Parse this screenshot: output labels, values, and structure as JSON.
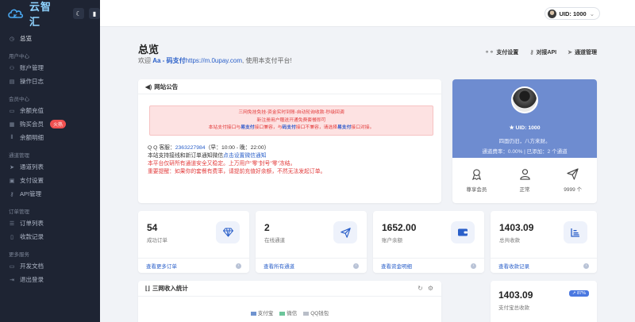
{
  "app": {
    "logo_text": "云智汇"
  },
  "sidebar": {
    "items": [
      {
        "type": "item",
        "icon": "dashboard-icon",
        "label": "总览",
        "active": true
      },
      {
        "type": "group",
        "label": "用户中心"
      },
      {
        "type": "item",
        "icon": "user-icon",
        "label": "账户管理"
      },
      {
        "type": "item",
        "icon": "log-icon",
        "label": "操作日志"
      },
      {
        "type": "group",
        "label": "会员中心"
      },
      {
        "type": "item",
        "icon": "wallet-icon",
        "label": "余额充值"
      },
      {
        "type": "item",
        "icon": "vip-icon",
        "label": "购买会员",
        "badge": "火热"
      },
      {
        "type": "item",
        "icon": "list-icon",
        "label": "余额明细"
      },
      {
        "type": "group",
        "label": "通道管理"
      },
      {
        "type": "item",
        "icon": "send-icon",
        "label": "通道列表"
      },
      {
        "type": "item",
        "icon": "settings-icon",
        "label": "支付设置"
      },
      {
        "type": "item",
        "icon": "key-icon",
        "label": "API管理"
      },
      {
        "type": "group",
        "label": "订单管理"
      },
      {
        "type": "item",
        "icon": "order-icon",
        "label": "订单列表"
      },
      {
        "type": "item",
        "icon": "record-icon",
        "label": "收款记录"
      },
      {
        "type": "group",
        "label": "更多服务"
      },
      {
        "type": "item",
        "icon": "doc-icon",
        "label": "开发文档"
      },
      {
        "type": "item",
        "icon": "logout-icon",
        "label": "退出登录"
      }
    ]
  },
  "topbar": {
    "uid_label": "UID: 1000"
  },
  "page": {
    "title": "总览",
    "welcome_prefix": "欢迎 ",
    "welcome_user": "Aa - 码支付",
    "welcome_site": "https://m.0upay.com",
    "welcome_suffix": ", 使用本支付平台!",
    "quick_links": [
      "支付设置",
      "对接API",
      "通道管理"
    ]
  },
  "notice": {
    "title": "网站公告",
    "alert_line1": "三网免挂免挂-资金实时到账-自动轮询收款-秒级回调",
    "alert_line2": "新注册用户赠送开通免费套餐即可",
    "alert_line3_a": "本站支付接口与",
    "alert_line3_b": "易支付",
    "alert_line3_c": "接口兼容，与",
    "alert_line3_d": "码支付",
    "alert_line3_e": "接口不兼容，请选择",
    "alert_line3_f": "易支付",
    "alert_line3_g": "接口对接。",
    "qq_prefix": "Q Q 客服：",
    "qq_number": "2363227984",
    "qq_hours": "（早：10:00 - 晚：22:00）",
    "wechat_prefix": "本站支持接线和新订单通知微信",
    "wechat_link": "点击设置微信通知",
    "risk_notice": "本平台仅研所有通道安全又稳定。上万用户\"零\"封号\"零\"冻结。",
    "warning": "重要提醒：如果你的套餐有费率，请提前充值好余额，不然无法发起订单。"
  },
  "profile": {
    "uid": "UID: 1000",
    "motto": "四面仍旧，八方来财。",
    "rate": "通道费率：0.00% | 已添加：2 个通道",
    "stats": [
      {
        "icon": "medal-icon",
        "label": "尊享会员"
      },
      {
        "icon": "person-icon",
        "label": "正常"
      },
      {
        "icon": "send-icon",
        "label": "9999 个"
      }
    ]
  },
  "stats": [
    {
      "value": "54",
      "label": "成功订单",
      "more": "查看更多订单",
      "icon": "diamond-icon"
    },
    {
      "value": "2",
      "label": "在线通道",
      "more": "查看所有通道",
      "icon": "send-icon"
    },
    {
      "value": "1652.00",
      "label": "账户余额",
      "more": "查看资金明细",
      "icon": "wallet-icon"
    },
    {
      "value": "1403.09",
      "label": "总共收款",
      "more": "查看收款记录",
      "icon": "bar-chart-icon"
    }
  ],
  "income": {
    "title": "三网收入统计",
    "legend": [
      {
        "label": "支付宝",
        "color": "#6f93cf"
      },
      {
        "label": "微信",
        "color": "#6cc59a"
      },
      {
        "label": "QQ钱包",
        "color": "#b9bec8"
      }
    ]
  },
  "alipay_card": {
    "value": "1403.09",
    "label": "支付宝总收款",
    "percent": "↗ 87%"
  },
  "colors": {
    "accent": "#2a5fc9",
    "sidebar_bg": "#1e2433",
    "profile_bg": "#6e8cd0",
    "danger": "#e23a3a"
  }
}
